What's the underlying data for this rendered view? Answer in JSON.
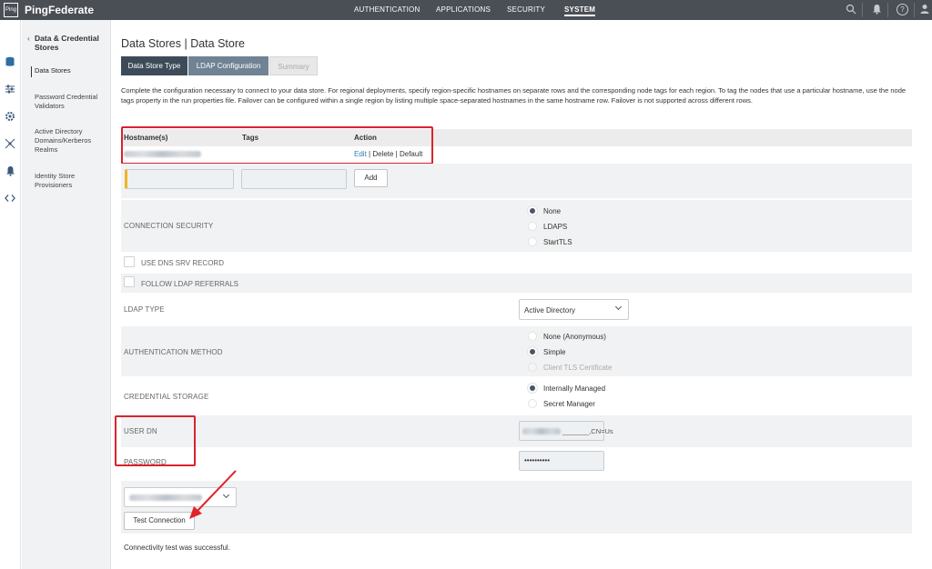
{
  "topbar": {
    "logo_text": "Ping",
    "brand": "PingFederate",
    "nav": [
      "AUTHENTICATION",
      "APPLICATIONS",
      "SECURITY",
      "SYSTEM"
    ],
    "active_nav": "SYSTEM",
    "help_label": "?"
  },
  "sidenav": {
    "back_label": "Data & Credential Stores",
    "items": [
      "Data Stores",
      "Password Credential Validators",
      "Active Directory Domains/Kerberos Realms",
      "Identity Store Provisioners"
    ]
  },
  "main": {
    "title": "Data Stores | Data Store",
    "tabs": [
      "Data Store Type",
      "LDAP Configuration",
      "Summary"
    ],
    "description": "Complete the configuration necessary to connect to your data store. For regional deployments, specify region-specific hostnames on separate rows and the corresponding node tags for each region. To tag the nodes that use a particular hostname, use the node tags property in the run properties file. Failover can be configured within a single region by listing multiple space-separated hostnames in the same hostname row. Failover is not supported across different rows."
  },
  "table": {
    "headers": [
      "Hostname(s)",
      "Tags",
      "Action"
    ],
    "actions": {
      "edit": "Edit",
      "delete": "Delete",
      "default": "Default",
      "sep": " | "
    },
    "add_button": "Add"
  },
  "connection_security": {
    "label": "CONNECTION SECURITY",
    "options": [
      "None",
      "LDAPS",
      "StartTLS"
    ],
    "selected": "None"
  },
  "dns_srv": {
    "label": "USE DNS SRV RECORD",
    "checked": false
  },
  "ldap_referrals": {
    "label": "FOLLOW LDAP REFERRALS",
    "checked": false
  },
  "ldap_type": {
    "label": "LDAP TYPE",
    "value": "Active Directory"
  },
  "auth_method": {
    "label": "AUTHENTICATION METHOD",
    "options": [
      "None (Anonymous)",
      "Simple",
      "Client TLS Certificate"
    ],
    "selected": "Simple",
    "disabled": [
      "Client TLS Certificate"
    ]
  },
  "credential_storage": {
    "label": "CREDENTIAL STORAGE",
    "options": [
      "Internally Managed",
      "Secret Manager"
    ],
    "selected": "Internally Managed"
  },
  "user_dn": {
    "label": "USER DN",
    "value_visible": "_______,CN=Us"
  },
  "password": {
    "label": "PASSWORD",
    "value": "••••••••••"
  },
  "test": {
    "button": "Test Connection",
    "result": "Connectivity test was successful."
  },
  "colors": {
    "accent": "#d9232d",
    "topbar": "#4a4e55",
    "tab_active": "#3d4b59",
    "tab_second": "#6f8394",
    "link": "#2b7bb9"
  }
}
